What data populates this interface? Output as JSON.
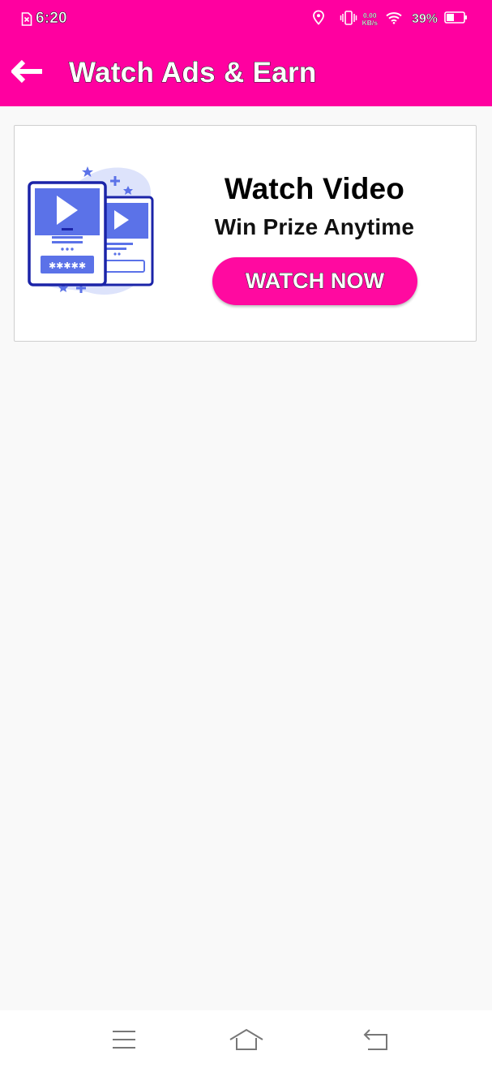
{
  "status_bar": {
    "time": "6:20",
    "net_speed_value": "0.00",
    "net_speed_unit": "KB/s",
    "battery_percent": "39%",
    "icons": [
      "sim-error-icon",
      "location-icon",
      "vibrate-icon",
      "wifi-icon",
      "battery-icon"
    ]
  },
  "app_bar": {
    "title": "Watch Ads & Earn",
    "back_icon": "arrow-left-icon"
  },
  "card": {
    "illustration_icon": "video-cards-illustration",
    "title": "Watch Video",
    "subtitle": "Win Prize Anytime",
    "button_label": "WATCH NOW"
  },
  "nav_bar": {
    "buttons": [
      "menu-icon",
      "home-icon",
      "back-icon"
    ]
  },
  "colors": {
    "brand": "#ff00a0",
    "button": "#ff0aa0",
    "background": "#f9f9f9",
    "illustration_blue": "#5b72e8"
  }
}
